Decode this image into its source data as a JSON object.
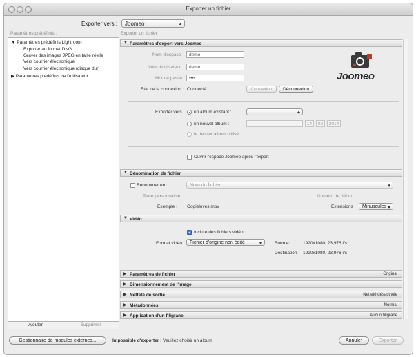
{
  "window": {
    "title": "Exporter un fichier"
  },
  "export_to": {
    "label": "Exporter vers :",
    "value": "Joomeo"
  },
  "presets": {
    "header": "Paramètres prédéfinis :",
    "groups": [
      {
        "label": "Paramètres prédéfinis Lightroom",
        "children": [
          "Exporter au format DNG",
          "Graver des images JPEG en taille réelle",
          "Vers courrier électronique",
          "Vers courrier électronique (disque dur)"
        ]
      },
      {
        "label": "Paramètres prédéfinis de l'utilisateur",
        "children": []
      }
    ],
    "add_label": "Ajouter",
    "delete_label": "Supprimer"
  },
  "right_header": "Exporter un fichier",
  "joomeo": {
    "title": "Paramètres d'export vers Joomeo",
    "space_label": "Nom d'espace",
    "space_value": "demo",
    "user_label": "Nom d'utilisateur",
    "user_value": "demo",
    "password_label": "Mot de passe",
    "password_value": "••••",
    "status_label": "Etat de la connexion :",
    "status_value": "Connecté",
    "connect_label": "Connexion",
    "disconnect_label": "Déconnexion",
    "logo_text": "Joomeo",
    "export_to_label": "Exporter vers :",
    "existing_album_label": "un album existant :",
    "new_album_label": "un nouvel album :",
    "date_day": "14",
    "date_month": "02",
    "date_year": "2014",
    "last_album_label": "le dernier album utilisé :",
    "open_space_label": "Ouvrir l'espace Joomeo après l'export"
  },
  "naming": {
    "title": "Dénomination de fichier",
    "rename_label": "Renommer en :",
    "rename_value": "Nom du fichier",
    "custom_text_label": "Texte personnalisé :",
    "start_number_label": "Numéro de début :",
    "example_label": "Exemple :",
    "example_value": "Oogieloves.mov",
    "extensions_label": "Extensions :",
    "extensions_value": "Minuscules"
  },
  "video": {
    "title": "Vidéo",
    "include_label": "Inclure des fichiers vidéo :",
    "format_label": "Format vidéo :",
    "format_value": "Fichier d'origine non édité",
    "source_label": "Source :",
    "source_value": "1920x1080, 23,976 i/s",
    "destination_label": "Destination :",
    "destination_value": "1920x1080, 23,976 i/s"
  },
  "collapsed_sections": [
    {
      "title": "Paramètres de fichier",
      "status": "Original"
    },
    {
      "title": "Dimensionnement de l'image",
      "status": ""
    },
    {
      "title": "Netteté de sortie",
      "status": "Netteté désactivée"
    },
    {
      "title": "Métadonnées",
      "status": "Normal"
    },
    {
      "title": "Application d'un filigrane",
      "status": "Aucun filigrane"
    }
  ],
  "footer": {
    "plugin_manager_label": "Gestionnaire de modules externes...",
    "error_bold": "Impossible d'exporter :",
    "error_text": "Veuillez choisir un album",
    "cancel_label": "Annuler",
    "export_label": "Exporter"
  },
  "colors": {
    "accent": "#4b84d8",
    "logo_red": "#c0392b"
  }
}
